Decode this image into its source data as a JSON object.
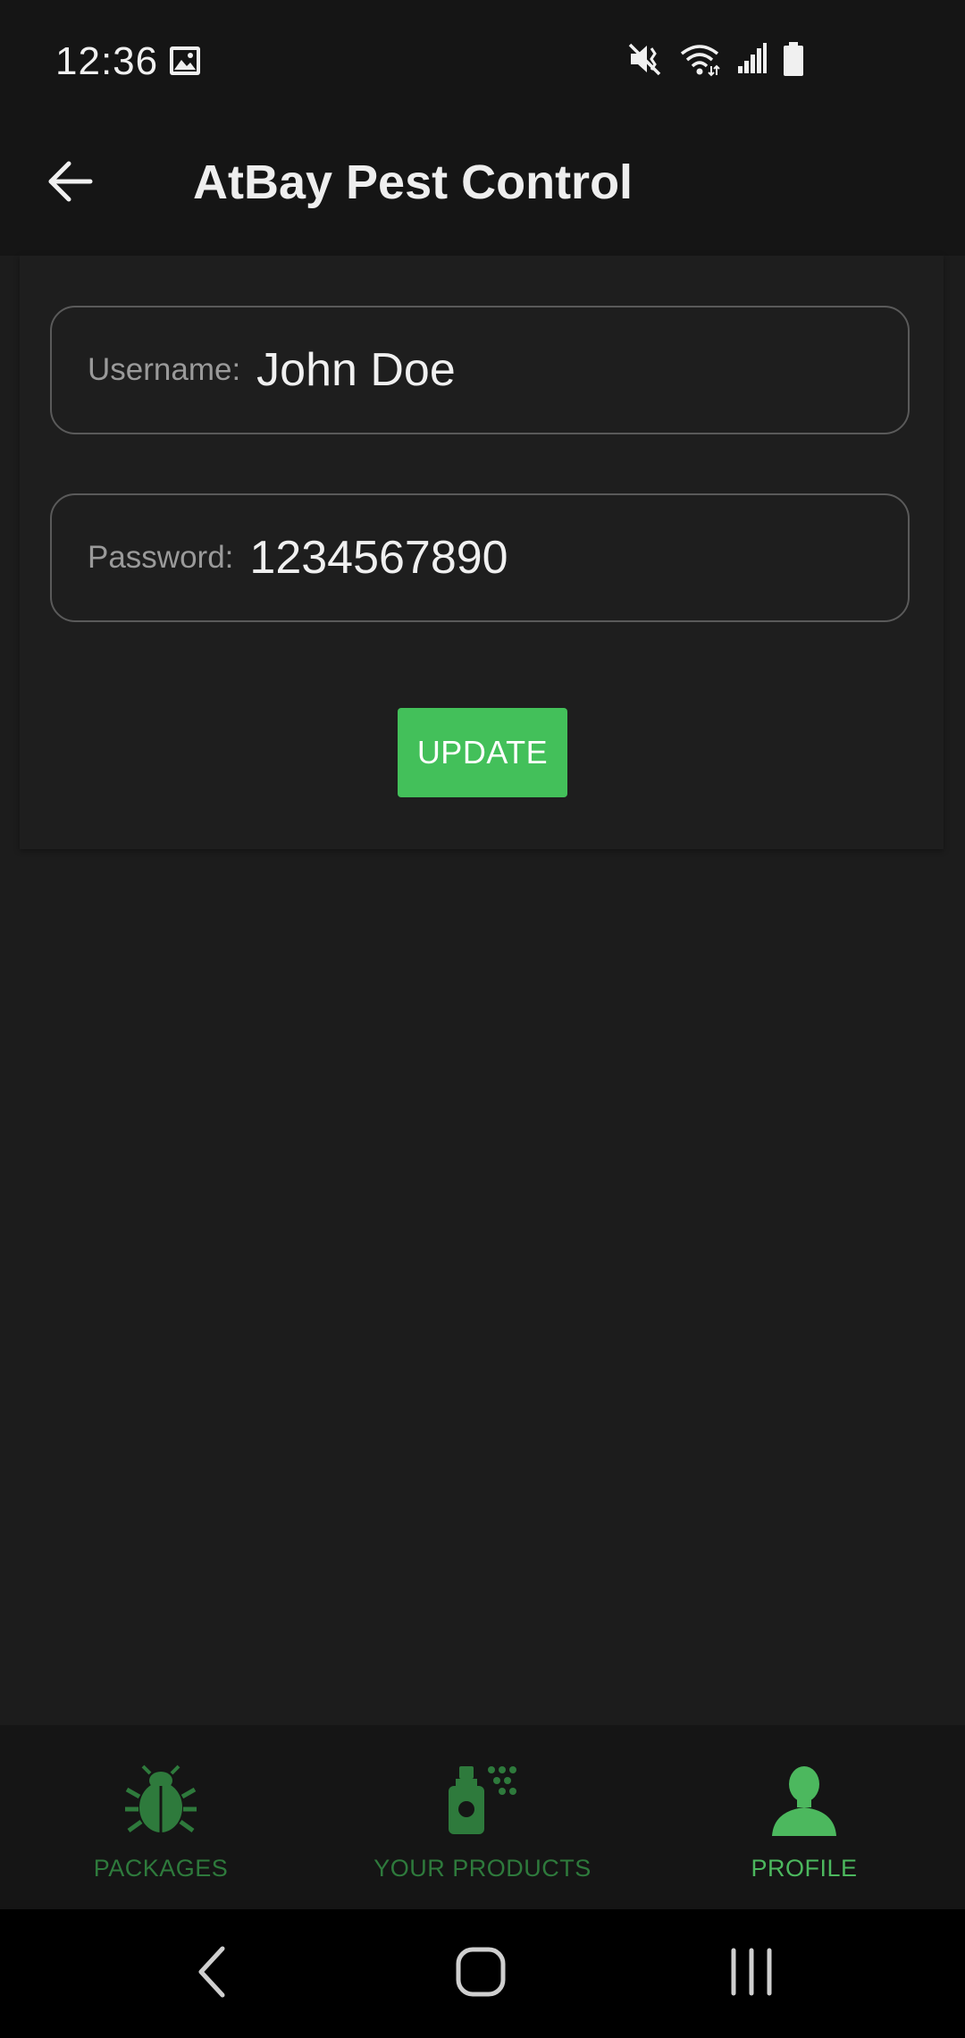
{
  "status_bar": {
    "time": "12:36",
    "icons": [
      "image-icon",
      "mute-icon",
      "wifi-icon",
      "signal-icon",
      "battery-icon"
    ]
  },
  "app_bar": {
    "title": "AtBay Pest Control",
    "back_icon": "arrow-left-icon"
  },
  "form": {
    "username": {
      "label": "Username:",
      "value": "John Doe"
    },
    "password": {
      "label": "Password:",
      "value": "1234567890"
    },
    "update_label": "UPDATE"
  },
  "bottom_nav": {
    "items": [
      {
        "label": "PACKAGES",
        "icon": "bug-icon",
        "active": false
      },
      {
        "label": "YOUR PRODUCTS",
        "icon": "spray-bottle-icon",
        "active": false
      },
      {
        "label": "PROFILE",
        "icon": "person-icon",
        "active": true
      }
    ]
  },
  "system_nav": {
    "icons": [
      "back-chevron-icon",
      "home-icon",
      "recent-apps-icon"
    ]
  },
  "colors": {
    "accent": "#43c05a",
    "nav_active": "#4cb85e",
    "nav_inactive": "#2e7a3c",
    "background": "#1c1c1c",
    "bar_background": "#151515"
  }
}
